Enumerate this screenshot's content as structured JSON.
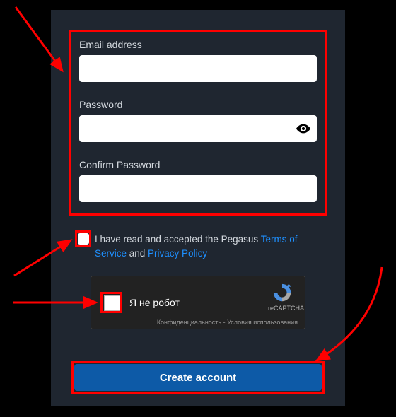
{
  "form": {
    "email_label": "Email address",
    "password_label": "Password",
    "confirm_label": "Confirm Password"
  },
  "terms": {
    "prefix": "I have read and accepted the Pegasus ",
    "tos": "Terms of Service",
    "middle": " and ",
    "privacy": "Privacy Policy"
  },
  "captcha": {
    "label": "Я не робот",
    "brand": "reCAPTCHA",
    "legal": "Конфиденциальность - Условия использования"
  },
  "button": {
    "create": "Create account"
  }
}
